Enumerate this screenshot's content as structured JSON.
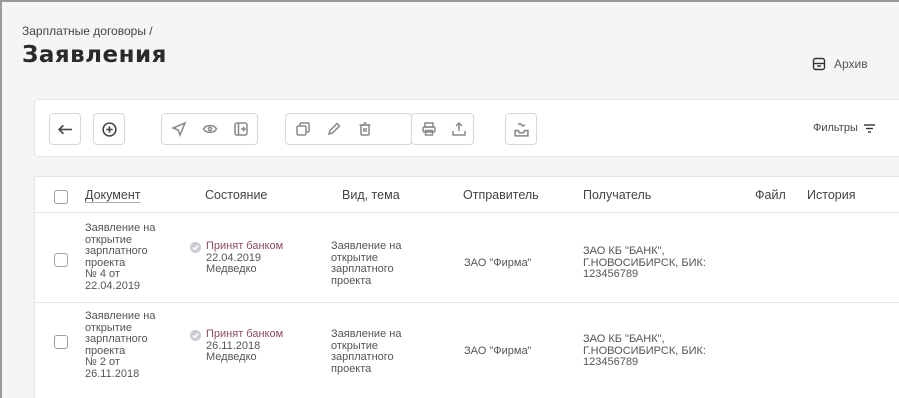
{
  "breadcrumb": "Зарплатные договоры /",
  "title": "Заявления",
  "archive_label": "Архив",
  "toolbar": {
    "filters_label": "Фильтры",
    "icons": [
      "back-arrow-icon",
      "add-icon",
      "send-icon",
      "view-icon",
      "sign-icon",
      "copy-icon",
      "edit-icon",
      "delete-icon",
      "print-icon",
      "export-icon",
      "import-icon"
    ]
  },
  "table": {
    "columns": {
      "document": "Документ",
      "state": "Состояние",
      "theme": "Вид, тема",
      "sender": "Отправитель",
      "recipient": "Получатель",
      "file": "Файл",
      "history": "История"
    },
    "rows": [
      {
        "doc": [
          "Заявление на",
          "открытие",
          "зарплатного",
          "проекта",
          "№ 4 от",
          "22.04.2019"
        ],
        "status": "Принят банком",
        "status_date": "22.04.2019",
        "status_user": "Медведко",
        "theme": [
          "Заявление на",
          "открытие",
          "зарплатного",
          "проекта"
        ],
        "sender": "ЗАО \"Фирма\"",
        "recipient": [
          "ЗАО КБ \"БАНК\",",
          "Г.НОВОСИБИРСК, БИК:",
          "123456789"
        ]
      },
      {
        "doc": [
          "Заявление на",
          "открытие",
          "зарплатного",
          "проекта",
          "№ 2 от",
          "26.11.2018"
        ],
        "status": "Принят банком",
        "status_date": "26.11.2018",
        "status_user": "Медведко",
        "theme": [
          "Заявление на",
          "открытие",
          "зарплатного",
          "проекта"
        ],
        "sender": "ЗАО \"Фирма\"",
        "recipient": [
          "ЗАО КБ \"БАНК\",",
          "Г.НОВОСИБИРСК, БИК:",
          "123456789"
        ]
      }
    ]
  },
  "colors": {
    "status_text": "#8a4a63",
    "status_icon": "#c9ccd1"
  }
}
